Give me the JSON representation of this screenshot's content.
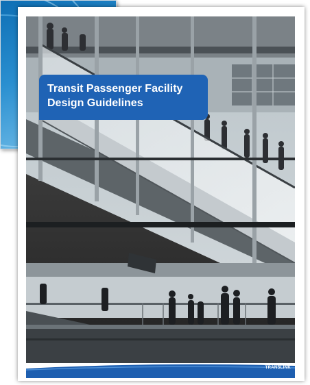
{
  "cover": {
    "title_line1": "Transit Passenger Facility",
    "title_line2": "Design Guidelines",
    "brand_color": "#1f63b5",
    "logo_text": "TRANSLINK"
  },
  "back_document": {
    "color": "#1f77c2"
  }
}
